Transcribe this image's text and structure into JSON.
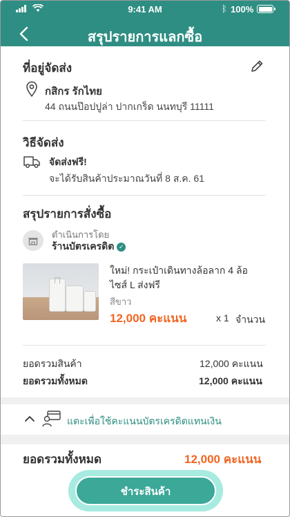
{
  "status_bar": {
    "time": "9:41 AM",
    "battery": "100%"
  },
  "header": {
    "title": "สรุปรายการแลกซื้อ"
  },
  "address": {
    "section_title": "ที่อยู่จัดส่ง",
    "name": "กสิกร รักไทย",
    "line": "44 ถนนป๊อปปูล่า ปากเกร็ด นนทบุรี 11111"
  },
  "shipping": {
    "section_title": "วิธีจัดส่ง",
    "method": "จัดส่งฟรี!",
    "eta": "จะได้รับสินค้าประมาณวันที่ 8 ส.ค. 61"
  },
  "order": {
    "section_title": "สรุปรายการสั่งซื้อ",
    "operated_by": "ดำเนินการโดย",
    "shop_name": "ร้านบัตรเครดิต",
    "item": {
      "name_line1": "ใหม่! กระเป๋าเดินทางล้อลาก 4 ล้อ",
      "name_line2": "ไซส์ L  ส่งฟรี",
      "variant": "สีขาว",
      "price": "12,000 คะแนน",
      "qty": "x 1",
      "qty_label": "จำนวน"
    }
  },
  "totals": {
    "subtotal_label": "ยอดรวมสินค้า",
    "subtotal_value": "12,000 คะแนน",
    "total_label": "ยอดรวมทั้งหมด",
    "total_value": "12,000 คะแนน"
  },
  "toggle": {
    "label": "แตะเพื่อใช้คะแนนบัตรเครดิตแทนเงิน"
  },
  "footer": {
    "total_label": "ยอดรวมทั้งหมด",
    "total_value": "12,000 คะแนน",
    "pay_button": "ชำระสินค้า"
  },
  "colors": {
    "brand": "#2f8e83",
    "accent": "#f26522",
    "button": "#3ba898"
  },
  "icons": [
    "back-icon",
    "edit-icon",
    "location-pin-icon",
    "truck-icon",
    "shop-icon",
    "verified-icon",
    "chevron-up-icon",
    "credit-card-user-icon"
  ]
}
